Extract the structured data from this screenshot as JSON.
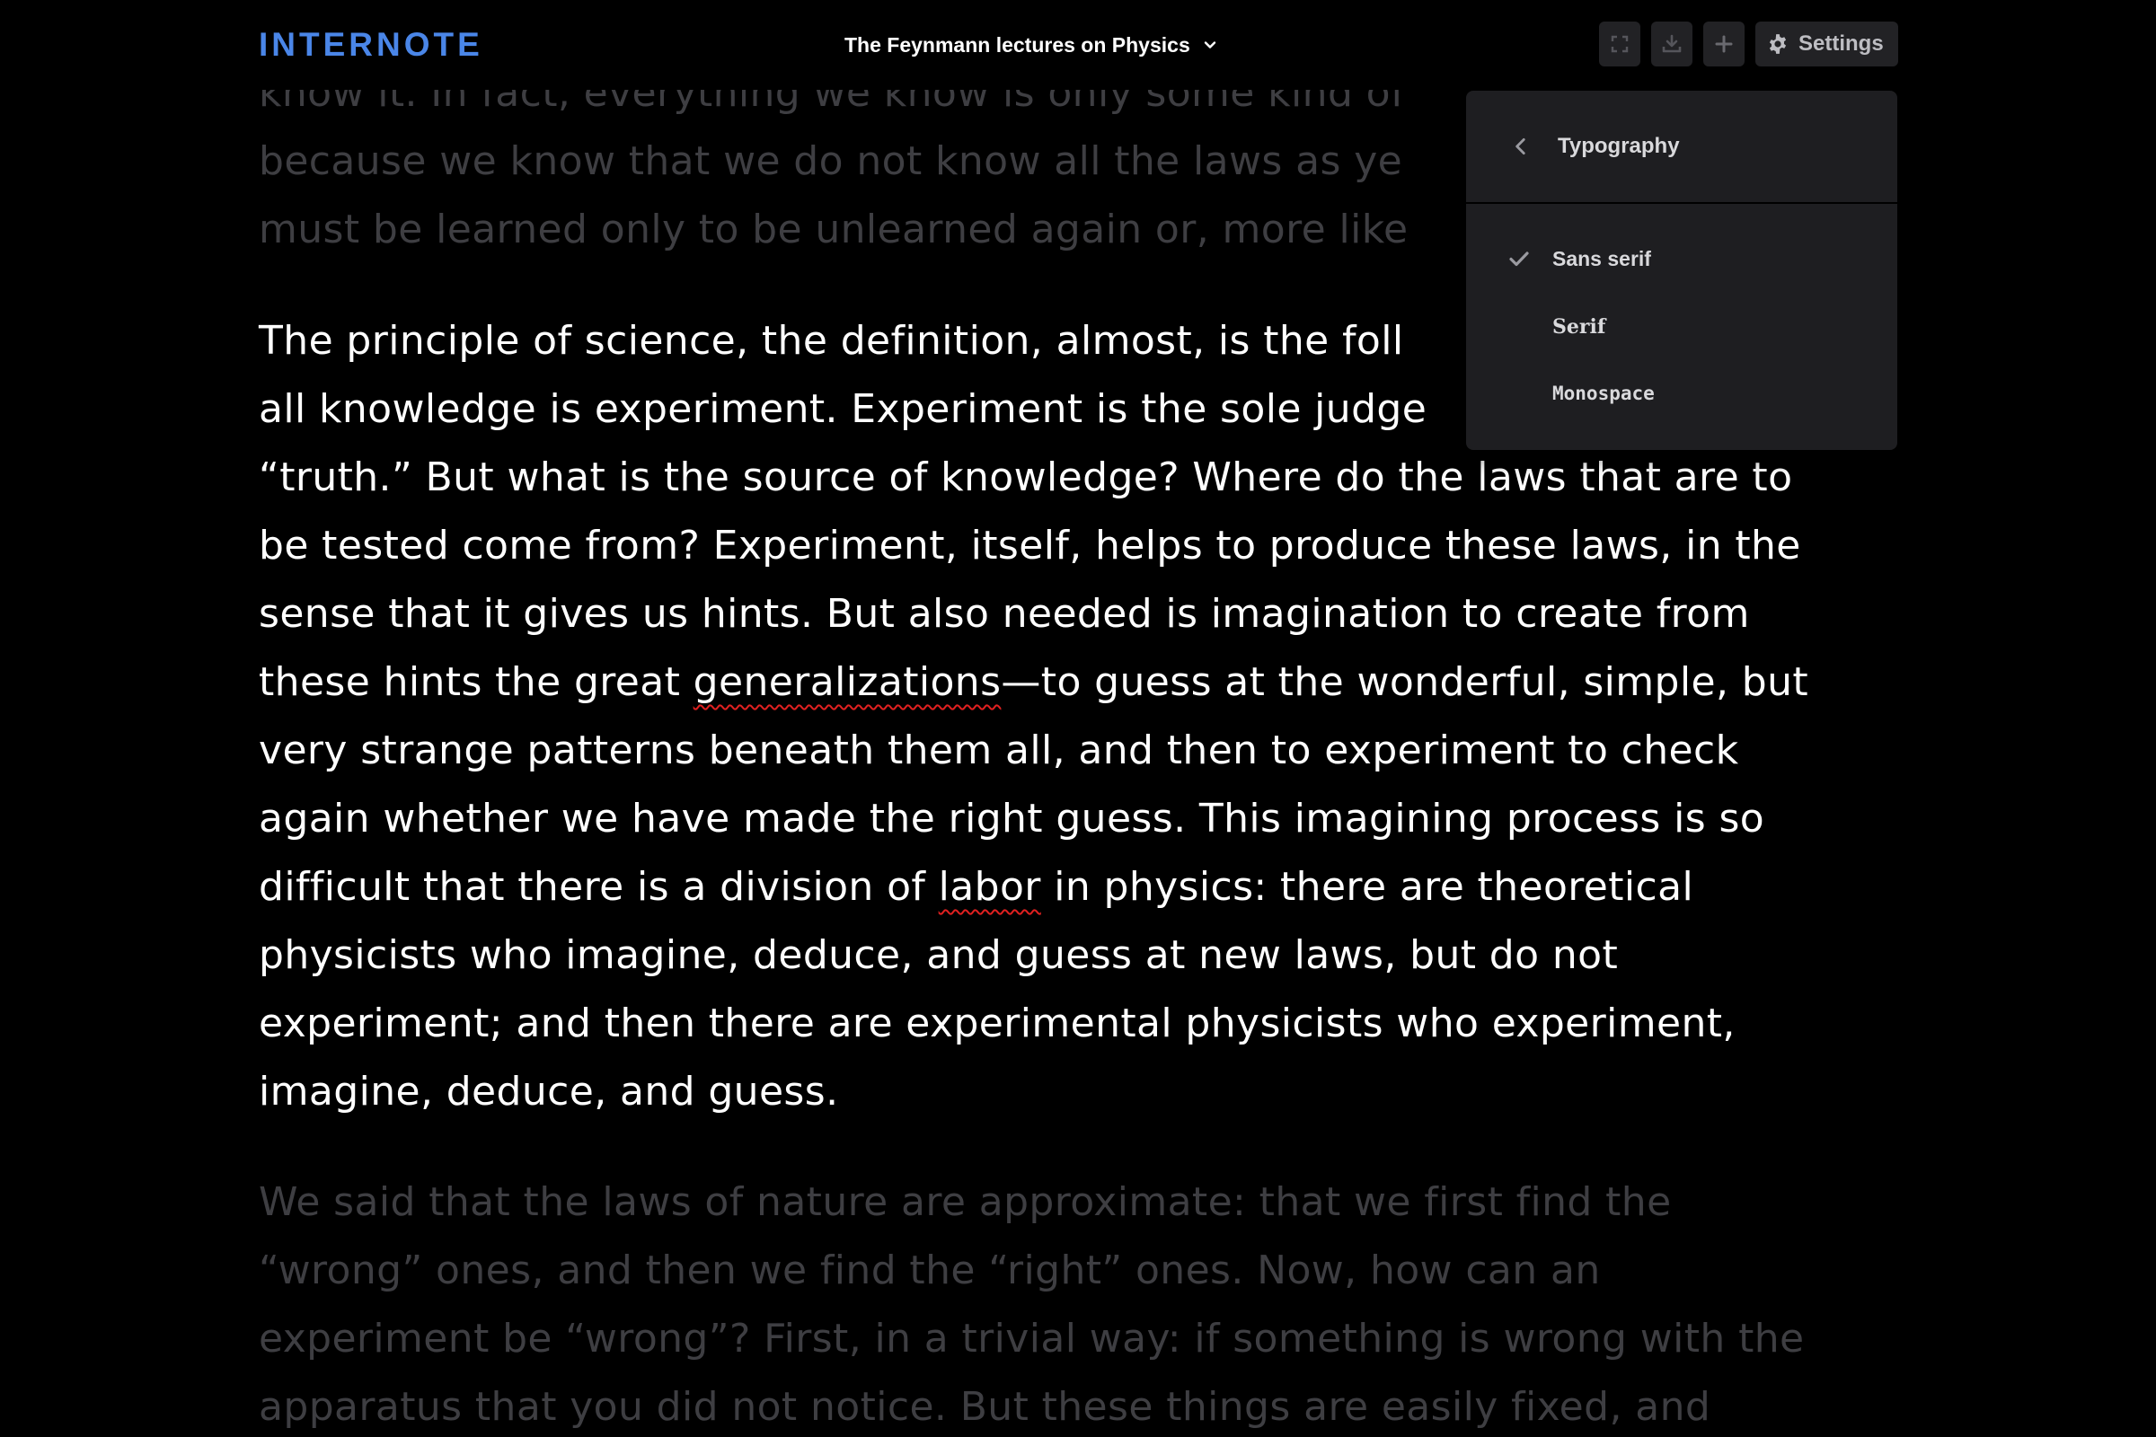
{
  "app": {
    "brand": "INTERNOTE",
    "document_title": "The Feynmann lectures on Physics"
  },
  "toolbar": {
    "buttons": [
      {
        "icon": "fullscreen-icon"
      },
      {
        "icon": "download-icon"
      },
      {
        "icon": "plus-icon"
      }
    ],
    "settings_label": "Settings",
    "settings_icon": "gear-icon"
  },
  "typography_menu": {
    "title": "Typography",
    "back_icon": "chevron-left-icon",
    "options": [
      {
        "label": "Sans serif",
        "selected": true
      },
      {
        "label": "Serif",
        "selected": false
      },
      {
        "label": "Monospace",
        "selected": false
      }
    ]
  },
  "document": {
    "paragraph_top_lines": [
      "know it. In fact, everything we know is only some kind of",
      "because we know that we do not know all the laws as ye",
      "must be learned only to be unlearned again or, more like"
    ],
    "paragraph_main": {
      "l1": "The principle of science, the definition, almost, is the foll",
      "l2": "all knowledge is experiment. Experiment is the sole judge",
      "l3": "“truth.” But what is the source of knowledge? Where do the laws that are to",
      "l4": "be tested come from? Experiment, itself, helps to produce these laws, in the",
      "l5": "sense that it gives us hints. But also needed is imagination to create from",
      "l6_pre": "these hints the great ",
      "l6_word": "generalizations",
      "l6_post": "—to guess at the wonderful, simple, but",
      "l7": "very strange patterns beneath them all, and then to experiment to check",
      "l8": "again whether we have made the right guess. This imagining process is so",
      "l9_pre": "difficult that there is a division of ",
      "l9_word": "labor",
      "l9_post": " in physics: there are theoretical",
      "l10": "physicists who imagine, deduce, and guess at new laws, but do not",
      "l11": "experiment; and then there are experimental physicists who experiment,",
      "l12": "imagine, deduce, and guess."
    },
    "paragraph_bottom_lines": [
      "We said that the laws of nature are approximate: that we first find the",
      "“wrong” ones, and then we find the “right” ones. Now, how can an",
      "experiment be “wrong”? First, in a trivial way: if something is wrong with the",
      "apparatus that you did not notice. But these things are easily fixed, and"
    ]
  },
  "colors": {
    "brand": "#4a86e8",
    "background": "#000000",
    "faded_text": "#3e3e42",
    "menu_bg": "#1e1e21",
    "spellcheck": "#e02020"
  }
}
